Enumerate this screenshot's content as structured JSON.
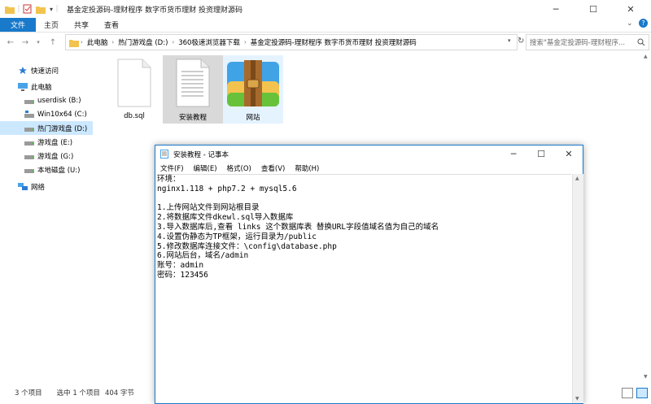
{
  "explorer": {
    "title": "基金定投源码-理财程序 数字币货币理财 投资理财源码",
    "ribbon_tabs": [
      "文件",
      "主页",
      "共享",
      "查看"
    ],
    "address": [
      "此电脑",
      "热门游戏盘 (D:)",
      "360极速浏览器下载",
      "基金定投源码-理财程序 数字币货币理财 投资理财源码"
    ],
    "search_placeholder": "搜索\"基金定投源码-理财程序...",
    "nav": {
      "quick_access": "快速访问",
      "this_pc": "此电脑",
      "drives": [
        "userdisk (B:)",
        "Win10x64 (C:)",
        "热门游戏盘 (D:)",
        "游戏盘 (E:)",
        "游戏盘 (G:)",
        "本地磁盘 (U:)"
      ],
      "network": "网络"
    },
    "files": [
      "db.sql",
      "安装教程",
      "网站"
    ],
    "status": {
      "count": "3 个项目",
      "selected": "选中 1 个项目",
      "size": "404 字节"
    }
  },
  "notepad": {
    "title": "安装教程 - 记事本",
    "menu": [
      "文件(F)",
      "编辑(E)",
      "格式(O)",
      "查看(V)",
      "帮助(H)"
    ],
    "lines": [
      "环境：",
      "nginx1.118 + php7.2 + mysql5.6",
      "",
      "1.上传网站文件到网站根目录",
      "2.将数据库文件dkewl.sql导入数据库",
      "3.导入数据库后,查看 links 这个数据库表 替换URL字段值域名值为自己的域名",
      "4.设置伪静态为TP框架，运行目录为/public",
      "5.修改数据库连接文件：\\config\\database.php",
      "6.网站后台，域名/admin",
      "账号：admin",
      "密码：123456"
    ]
  },
  "colors": {
    "accent": "#1979ca",
    "selection": "#cce8ff",
    "folder": "#f3c34f"
  }
}
